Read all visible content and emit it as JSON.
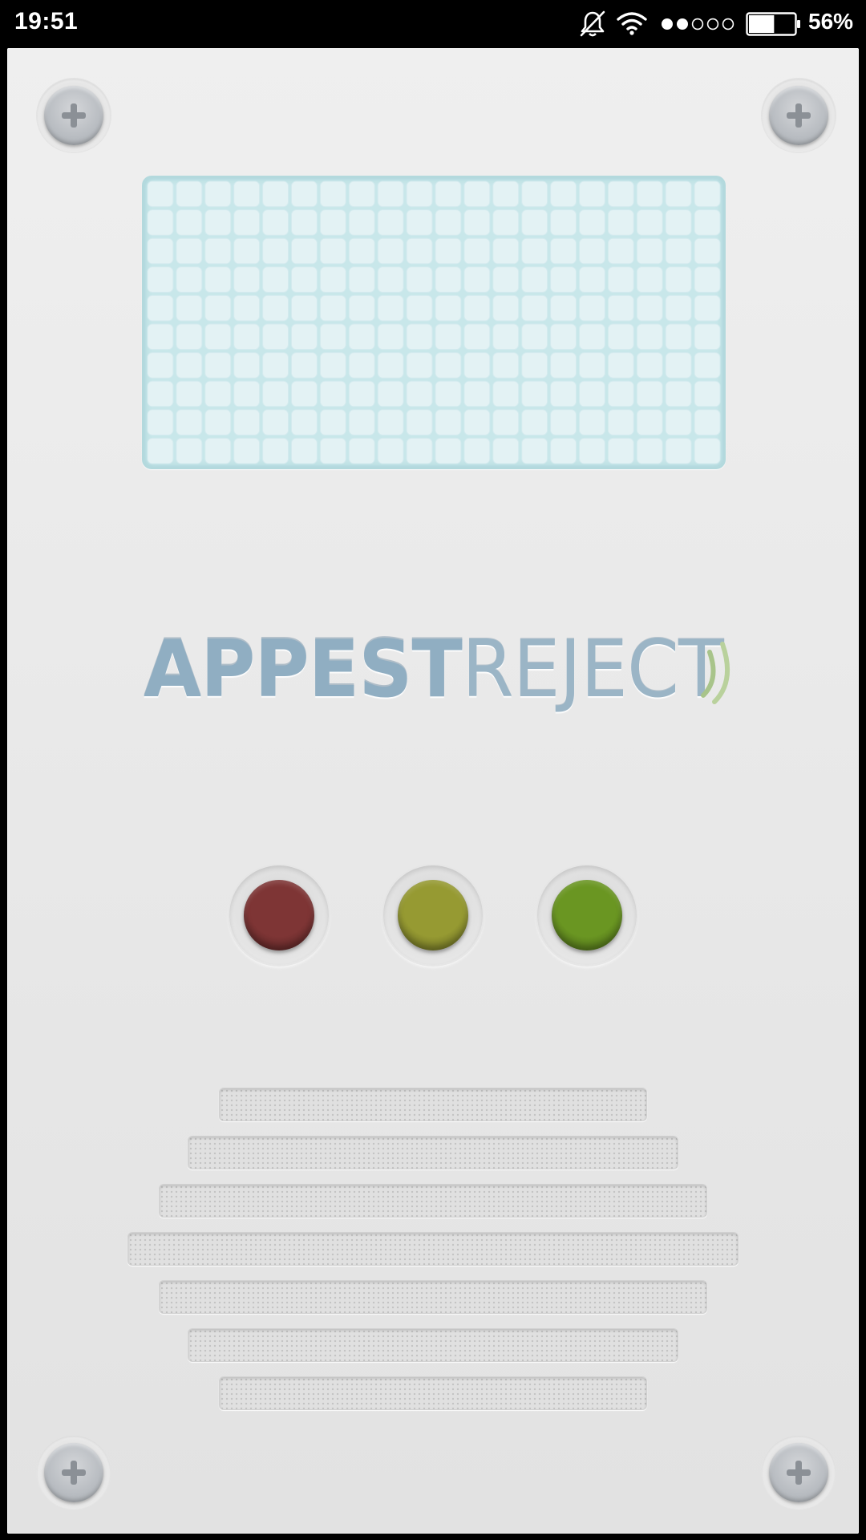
{
  "status_bar": {
    "time": "19:51",
    "icons": [
      "bell-off-icon",
      "wifi-icon",
      "signal-dots-icon",
      "battery-icon"
    ],
    "battery_percent": "56%",
    "battery_level": 0.56,
    "signal_strength_filled": 2,
    "signal_strength_total": 5
  },
  "panel": {
    "display": {
      "state": "blank",
      "grid_columns": 20,
      "grid_rows": 10,
      "color": "#c8e7ea"
    },
    "logo": {
      "bold_text": "APPEST",
      "light_text": "REJECT",
      "accent_icon": "signal-waves-icon",
      "accent_color": "#a8c48a"
    },
    "lights": [
      {
        "name": "red",
        "color": "#7e3535"
      },
      {
        "name": "yellow",
        "color": "#969a32"
      },
      {
        "name": "green",
        "color": "#6a9622"
      }
    ],
    "speaker_slots": 7,
    "screws": [
      "top-left",
      "top-right",
      "bottom-left",
      "bottom-right"
    ]
  }
}
